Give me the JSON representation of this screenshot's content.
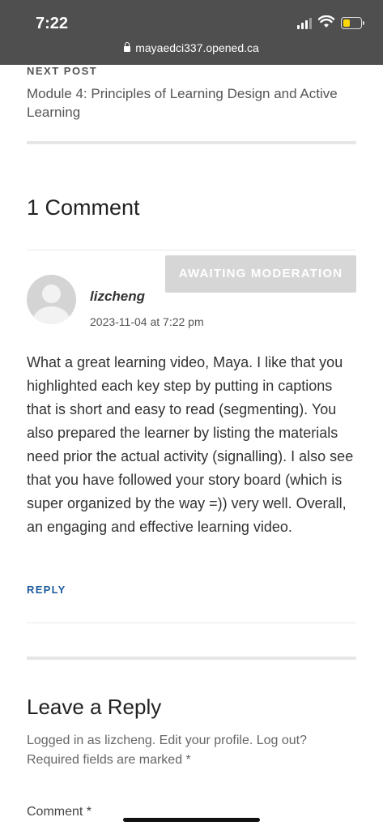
{
  "status_bar": {
    "time": "7:22",
    "url": "mayaedci337.opened.ca",
    "battery_level": 0.3,
    "signal_bars_active": 3
  },
  "post_nav": {
    "label": "NEXT POST",
    "title": "Module 4: Principles of Learning Design and Active Learning"
  },
  "comments": {
    "heading": "1 Comment",
    "badge": "AWAITING MODERATION",
    "author": "lizcheng",
    "date": "2023-11-04 at 7:22 pm",
    "text": "What a great learning video, Maya. I like that you highlighted each key step by putting in captions that is short and easy to read (segmenting). You also prepared the learner by listing the materials need prior the actual activity (signalling). I also see that you have followed your story board (which is super organized by the way =)) very well. Overall, an engaging and effective learning video.",
    "reply_label": "REPLY"
  },
  "reply_form": {
    "heading": "Leave a Reply",
    "logged_in_text": "Logged in as lizcheng. Edit your profile. Log out? Required fields are marked *",
    "comment_label": "Comment *"
  },
  "colors": {
    "status_bar_bg": "#4f4f4f",
    "link": "#1d5a9c",
    "badge_bg": "#d6d6d6",
    "battery": "#ffd60a"
  }
}
